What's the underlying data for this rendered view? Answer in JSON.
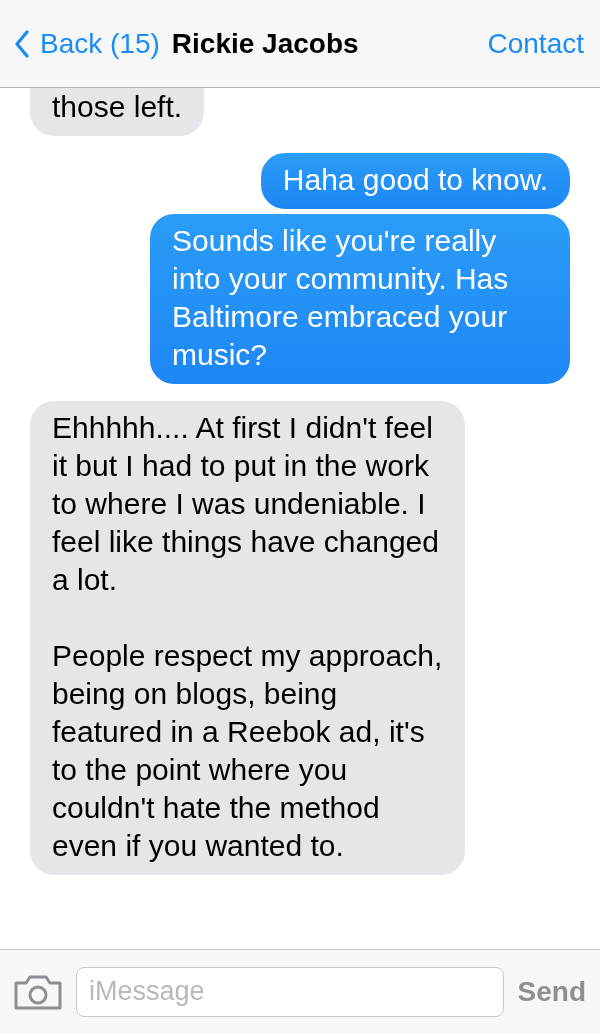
{
  "nav": {
    "back_label": "Back (15)",
    "title": "Rickie Jacobs",
    "action": "Contact"
  },
  "messages": [
    {
      "kind": "received",
      "paragraphs": [
        "those left."
      ]
    },
    {
      "kind": "sent",
      "paragraphs": [
        "Haha good to know."
      ]
    },
    {
      "kind": "sent",
      "paragraphs": [
        "Sounds like you're really into your community. Has Baltimore embraced your music?"
      ]
    },
    {
      "kind": "received",
      "paragraphs": [
        "Ehhhhh.... At first I didn't feel it but I had to put in the work to where I was undeniable. I feel like things have changed a lot.",
        "People respect my approach, being on blogs, being featured in a Reebok ad, it's to the point where you couldn't hate the method even if you wanted to."
      ]
    }
  ],
  "compose": {
    "placeholder": "iMessage",
    "send_label": "Send",
    "send_disabled": true
  }
}
